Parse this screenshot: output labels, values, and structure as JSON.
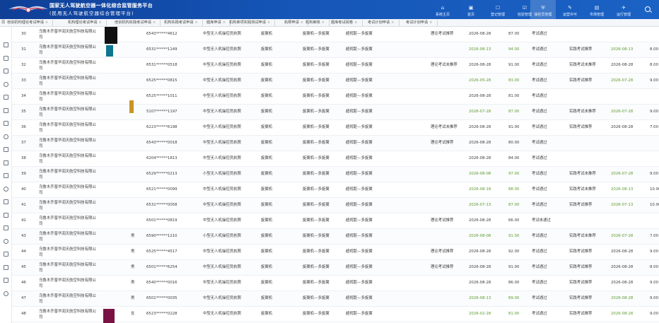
{
  "header": {
    "title": "国家无人驾驶航空器一体化综合监管服务平台",
    "subtitle": "(民用无人驾驶航空器综合管理平台)",
    "nav": [
      {
        "label": "系统主页",
        "icon": "home-icon"
      },
      {
        "label": "首页",
        "icon": "dashboard-icon"
      },
      {
        "label": "登记管理",
        "icon": "register-icon"
      },
      {
        "label": "检验管理",
        "icon": "inspect-icon"
      },
      {
        "label": "操控员管理",
        "icon": "shield-icon"
      },
      {
        "label": "运营许可",
        "icon": "permit-icon"
      },
      {
        "label": "市场管理",
        "icon": "market-icon"
      },
      {
        "label": "运行管理",
        "icon": "flight-icon"
      },
      {
        "label": "系统管理",
        "icon": "settings-icon"
      }
    ],
    "active_nav": "操控员管理"
  },
  "tabs": [
    "培训机构理论考试申请",
    "机构理论考试申请",
    "培训机构实践考试申请",
    "机构实践考试申请",
    "题库申请",
    "机构单项实践测试申请",
    "执照申请",
    "机构审核",
    "题库考试阅卷",
    "考试计划申请",
    "考试计划申请"
  ],
  "rows": [
    {
      "no": "30",
      "org": "乌鲁木齐普华润天航空科技有限公司",
      "gender": "",
      "id": "6543******4612",
      "lic": "中型无人机操控员执照",
      "type": "旋翼机",
      "cls": "旋翼机—多旋翼",
      "sub": "超视距—多旋翼",
      "theory": "理论考试推荐",
      "date": "2026-08-28",
      "score": "87.00",
      "result": "考试通过",
      "prac": "",
      "pdate": "",
      "pscore": ""
    },
    {
      "no": "31",
      "org": "乌鲁木齐普华润天航空科技有限公司",
      "gender": "",
      "id": "6531******1149",
      "lic": "中型无人机操控员执照",
      "type": "旋翼机",
      "cls": "旋翼机—多旋翼",
      "sub": "超视距—多旋翼",
      "theory": "",
      "date": "2026-08-13",
      "score": "94.00",
      "result": "考试通过",
      "prac": "实践考试推荐",
      "pdate": "2026-08-13",
      "pscore": "8.00",
      "green": true
    },
    {
      "no": "32",
      "org": "乌鲁木齐普华润天航空科技有限公司",
      "gender": "",
      "id": "6531******0518",
      "lic": "中型无人机操控员执照",
      "type": "旋翼机",
      "cls": "旋翼机—多旋翼",
      "sub": "超视距—多旋翼",
      "theory": "理论考试未推荐",
      "date": "2026-08-28",
      "score": "91.00",
      "result": "考试通过",
      "prac": "实践考试未推荐",
      "pdate": "2026-08-28",
      "pscore": "8.00"
    },
    {
      "no": "33",
      "org": "乌鲁木齐普华润天航空科技有限公司",
      "gender": "",
      "id": "6525******0815",
      "lic": "中型无人机操控员执照",
      "type": "旋翼机",
      "cls": "旋翼机—多旋翼",
      "sub": "超视距—多旋翼",
      "theory": "",
      "date": "2026-05-28",
      "score": "83.00",
      "result": "考试通过",
      "prac": "实践考试推荐",
      "pdate": "2026-07-28",
      "pscore": "9.00",
      "green": true
    },
    {
      "no": "34",
      "org": "乌鲁木齐普华润天航空科技有限公司",
      "gender": "",
      "id": "6525******1011",
      "lic": "中型无人机操控员执照",
      "type": "旋翼机",
      "cls": "旋翼机—多旋翼",
      "sub": "超视距—多旋翼",
      "theory": "",
      "date": "2026-08-28",
      "score": "81.00",
      "result": "考试通过",
      "prac": "",
      "pdate": "",
      "pscore": ""
    },
    {
      "no": "35",
      "org": "乌鲁木齐普华润天航空科技有限公司",
      "gender": "",
      "id": "5107******1197",
      "lic": "中型无人机操控员执照",
      "type": "旋翼机",
      "cls": "旋翼机—多旋翼",
      "sub": "超视距—多旋翼",
      "theory": "",
      "date": "2026-07-28",
      "score": "87.00",
      "result": "考试通过",
      "prac": "实践考试未推荐",
      "pdate": "2026-07-28",
      "pscore": "9.00",
      "green": true
    },
    {
      "no": "36",
      "org": "乌鲁木齐普华润天航空科技有限公司",
      "gender": "",
      "id": "6223******6198",
      "lic": "中型无人机操控员执照",
      "type": "旋翼机",
      "cls": "旋翼机—多旋翼",
      "sub": "超视距—多旋翼",
      "theory": "理论考试未推荐",
      "date": "2026-08-28",
      "score": "91.00",
      "result": "考试通过",
      "prac": "实践考试推荐",
      "pdate": "2026-08-28",
      "pscore": "7.00"
    },
    {
      "no": "37",
      "org": "乌鲁木齐普华润天航空科技有限公司",
      "gender": "",
      "id": "6543******0018",
      "lic": "中型无人机操控员执照",
      "type": "旋翼机",
      "cls": "旋翼机—多旋翼",
      "sub": "超视距—多旋翼",
      "theory": "理论考试推荐",
      "date": "2026-08-28",
      "score": "80.00",
      "result": "考试通过",
      "prac": "",
      "pdate": "",
      "pscore": ""
    },
    {
      "no": "38",
      "org": "乌鲁木齐普华润天航空科技有限公司",
      "gender": "",
      "id": "6204******1813",
      "lic": "中型无人机操控员执照",
      "type": "旋翼机",
      "cls": "旋翼机—多旋翼",
      "sub": "超视距—多旋翼",
      "theory": "",
      "date": "2026-08-28",
      "score": "84.00",
      "result": "考试通过",
      "prac": "",
      "pdate": "",
      "pscore": ""
    },
    {
      "no": "39",
      "org": "乌鲁木齐普华润天航空科技有限公司",
      "gender": "",
      "id": "6529******0213",
      "lic": "小型无人机操控员执照",
      "type": "旋翼机",
      "cls": "旋翼机—多旋翼",
      "sub": "超视距—多旋翼",
      "theory": "",
      "date": "2026-08-08",
      "score": "97.00",
      "result": "考试通过",
      "prac": "实践考试未推荐",
      "pdate": "2026-07-28",
      "pscore": "9.00",
      "green": true
    },
    {
      "no": "40",
      "org": "乌鲁木齐普华润天航空科技有限公司",
      "gender": "",
      "id": "6521******0099",
      "lic": "中型无人机操控员执照",
      "type": "旋翼机",
      "cls": "旋翼机—多旋翼",
      "sub": "超视距—多旋翼",
      "theory": "",
      "date": "2026-08-18",
      "score": "88.00",
      "result": "考试通过",
      "prac": "实践考试未推荐",
      "pdate": "2026-08-13",
      "pscore": "10.00",
      "green": true
    },
    {
      "no": "41",
      "org": "乌鲁木齐普华润天航空科技有限公司",
      "gender": "",
      "id": "6531******0058",
      "lic": "中型无人机操控员执照",
      "type": "旋翼机",
      "cls": "旋翼机—多旋翼",
      "sub": "超视距—多旋翼",
      "theory": "",
      "date": "2026-07-13",
      "score": "87.00",
      "result": "考试通过",
      "prac": "实践考试推荐",
      "pdate": "2026-07-13",
      "pscore": "10.00",
      "green": true
    },
    {
      "no": "42",
      "org": "乌鲁木齐普华润天航空科技有限公司",
      "gender": "",
      "id": "6501******0819",
      "lic": "中型无人机操控员执照",
      "type": "旋翼机",
      "cls": "旋翼机—多旋翼",
      "sub": "超视距—多旋翼",
      "theory": "理论考试推荐",
      "date": "2026-08-28",
      "score": "66.00",
      "result": "考试未通过",
      "prac": "",
      "pdate": "",
      "pscore": ""
    },
    {
      "no": "43",
      "org": "乌鲁木齐普华润天航空科技有限公司",
      "gender": "男",
      "id": "6590******1210",
      "lic": "小型无人机操控员执照",
      "type": "旋翼机",
      "cls": "旋翼机—多旋翼",
      "sub": "超视距—多旋翼",
      "theory": "",
      "date": "2026-08-08",
      "score": "91.00",
      "result": "考试通过",
      "prac": "实践考试未推荐",
      "pdate": "2026-07-28",
      "pscore": "7.00",
      "green": true
    },
    {
      "no": "44",
      "org": "乌鲁木齐普华润天航空科技有限公司",
      "gender": "男",
      "id": "6525******4517",
      "lic": "中型无人机操控员执照",
      "type": "旋翼机",
      "cls": "旋翼机—多旋翼",
      "sub": "超视距—多旋翼",
      "theory": "理论考试推荐",
      "date": "2026-08-28",
      "score": "92.00",
      "result": "考试通过",
      "prac": "实践考试推荐",
      "pdate": "2026-08-28",
      "pscore": "9.00"
    },
    {
      "no": "45",
      "org": "乌鲁木齐普华润天航空科技有限公司",
      "gender": "男",
      "id": "6501******6254",
      "lic": "中型无人机操控员执照",
      "type": "旋翼机",
      "cls": "旋翼机—多旋翼",
      "sub": "超视距—多旋翼",
      "theory": "理论考试推荐",
      "date": "2026-08-28",
      "score": "91.00",
      "result": "考试通过",
      "prac": "实践考试推荐",
      "pdate": "2026-08-28",
      "pscore": "8.00"
    },
    {
      "no": "46",
      "org": "乌鲁木齐普华润天航空科技有限公司",
      "gender": "男",
      "id": "6540******0016",
      "lic": "中型无人机操控员执照",
      "type": "旋翼机",
      "cls": "旋翼机—多旋翼",
      "sub": "超视距—多旋翼",
      "theory": "",
      "date": "2026-08-28",
      "score": "86.00",
      "result": "考试通过",
      "prac": "实践考试推荐",
      "pdate": "2026-08-28",
      "pscore": "9.00"
    },
    {
      "no": "47",
      "org": "乌鲁木齐普华润天航空科技有限公司",
      "gender": "男",
      "id": "6501******0035",
      "lic": "中型无人机操控员执照",
      "type": "旋翼机",
      "cls": "旋翼机—多旋翼",
      "sub": "超视距—多旋翼",
      "theory": "",
      "date": "2026-08-13",
      "score": "89.00",
      "result": "考试通过",
      "prac": "实践考试推荐",
      "pdate": "2026-08-28",
      "pscore": "9.00",
      "green": true
    },
    {
      "no": "48",
      "org": "乌鲁木齐普华润天航空科技有限公司",
      "gender": "女",
      "id": "6523******0228",
      "lic": "中型无人机操控员执照",
      "type": "旋翼机",
      "cls": "旋翼机—多旋翼",
      "sub": "超视距—多旋翼",
      "theory": "",
      "date": "2026-02-28",
      "score": "81.00",
      "result": "考试通过",
      "prac": "实践考试推荐",
      "pdate": "2026-08-28",
      "pscore": "9.00",
      "green": true
    }
  ],
  "colors": {
    "header": "#1556b8",
    "pass_green": "#5c9a2c"
  }
}
